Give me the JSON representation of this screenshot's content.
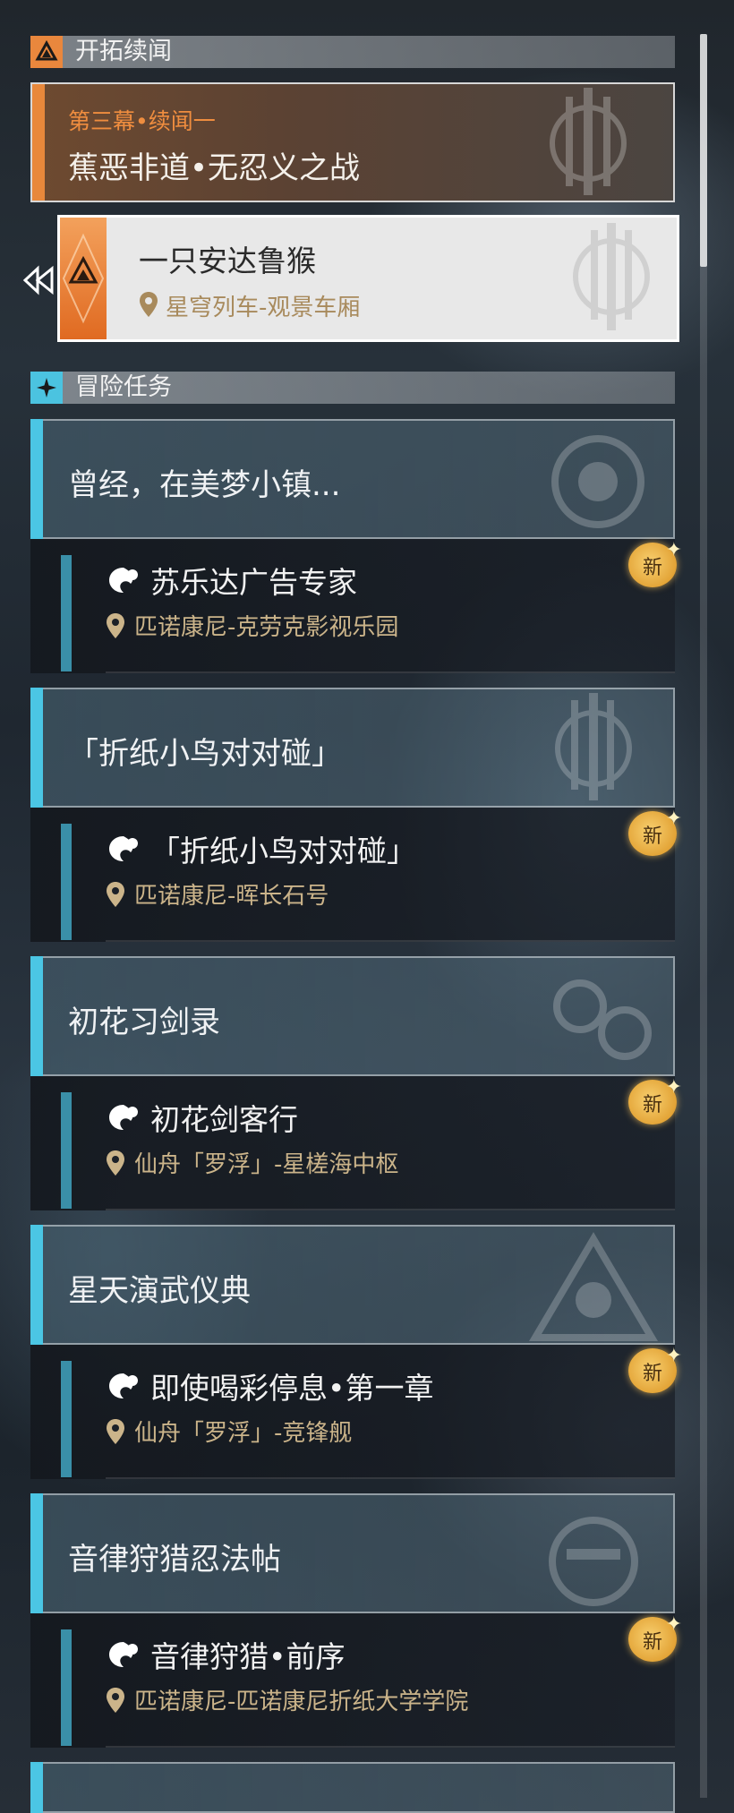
{
  "trailblaze": {
    "section_title": "开拓续闻",
    "chapter": {
      "subtitle": "第三幕•续闻一",
      "title": "蕉恶非道•无忍义之战"
    },
    "mission": {
      "title": "一只安达鲁猴",
      "location": "星穹列车-观景车厢"
    }
  },
  "adventure": {
    "section_title": "冒险任务",
    "quests": [
      {
        "title": "曾经，在美梦小镇...",
        "mission": "苏乐达广告专家",
        "location": "匹诺康尼-克劳克影视乐园",
        "badge": "新"
      },
      {
        "title": "「折纸小鸟对对碰」",
        "mission": "「折纸小鸟对对碰」",
        "location": "匹诺康尼-晖长石号",
        "badge": "新"
      },
      {
        "title": "初花习剑录",
        "mission": "初花剑客行",
        "location": "仙舟「罗浮」-星槎海中枢",
        "badge": "新"
      },
      {
        "title": "星天演武仪典",
        "mission": "即使喝彩停息•第一章",
        "location": "仙舟「罗浮」-竞锋舰",
        "badge": "新"
      },
      {
        "title": "音律狩猎忍法帖",
        "mission": "音律狩猎•前序",
        "location": "匹诺康尼-匹诺康尼折纸大学学院",
        "badge": "新"
      }
    ]
  },
  "colors": {
    "trailblaze_accent": "#e8883b",
    "adventure_accent": "#4bc6e4",
    "location_text": "#cbb48a",
    "new_badge": "#e3a437"
  }
}
